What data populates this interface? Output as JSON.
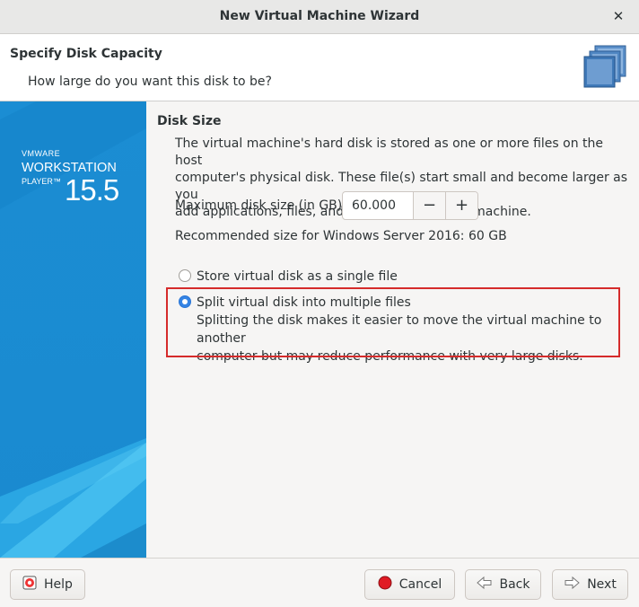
{
  "window": {
    "title": "New Virtual Machine Wizard",
    "close_glyph": "✕"
  },
  "header": {
    "title": "Specify Disk Capacity",
    "subtitle": "How large do you want this disk to be?",
    "icon": "stacked-disks-icon"
  },
  "sidebar": {
    "brand_small": "VMWARE",
    "brand_line1": "WORKSTATION",
    "brand_line2": "PLAYER™",
    "version": "15.5",
    "colors": {
      "primary": "#1d8ed2",
      "light": "#29b6ea",
      "dark": "#0f72b6"
    }
  },
  "content": {
    "section_title": "Disk Size",
    "description_lines": [
      "The virtual machine's hard disk is stored as one or more files on the host",
      "computer's physical disk. These file(s) start small and become larger as you",
      "add applications, files, and data to your virtual machine."
    ],
    "max_size_label": "Maximum disk size (in GB):",
    "max_size_value": "60.000",
    "decrement_glyph": "−",
    "increment_glyph": "+",
    "recommended": "Recommended size for Windows Server 2016: 60 GB",
    "options": [
      {
        "label": "Store virtual disk as a single file",
        "selected": false
      },
      {
        "label": "Split virtual disk into multiple files",
        "selected": true
      }
    ],
    "split_description_lines": [
      "Splitting the disk makes it easier to move the virtual machine to another",
      "computer but may reduce performance with very large disks."
    ],
    "highlight_color": "#d52b2b",
    "accent_color": "#3584e4"
  },
  "footer": {
    "help": "Help",
    "cancel": "Cancel",
    "back": "Back",
    "next": "Next"
  }
}
